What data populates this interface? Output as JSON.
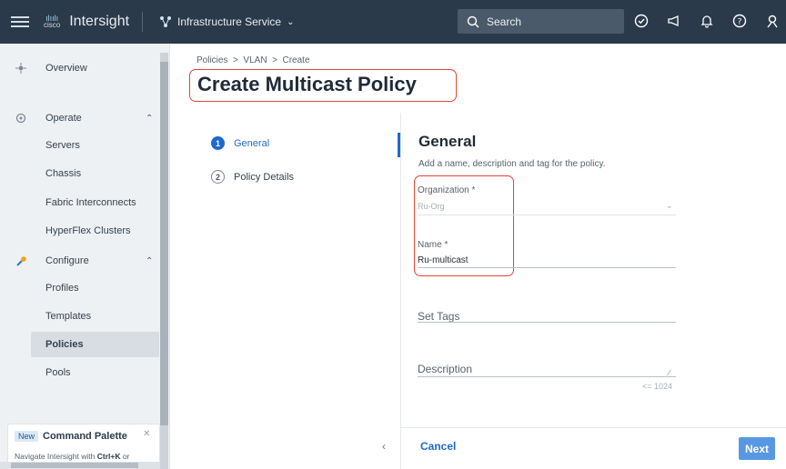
{
  "topbar": {
    "logo_text": "cisco",
    "brand": "Intersight",
    "service": "Infrastructure Service",
    "search_label": "Search"
  },
  "nav": {
    "overview": "Overview",
    "operate": "Operate",
    "servers": "Servers",
    "chassis": "Chassis",
    "fabric": "Fabric Interconnects",
    "hyperflex": "HyperFlex Clusters",
    "configure": "Configure",
    "profiles": "Profiles",
    "templates": "Templates",
    "policies": "Policies",
    "pools": "Pools"
  },
  "command_palette": {
    "badge": "New",
    "title": "Command Palette",
    "desc_prefix": "Navigate Intersight with ",
    "desc_key": "Ctrl+K",
    "desc_suffix": " or"
  },
  "breadcrumb": "Policies  >  VLAN  >  Create",
  "page_title": "Create Multicast Policy",
  "steps": [
    {
      "num": "1",
      "label": "General"
    },
    {
      "num": "2",
      "label": "Policy Details"
    }
  ],
  "form": {
    "title": "General",
    "subtitle": "Add a name, description and tag for the policy.",
    "org_label": "Organization *",
    "org_value": "Ru-Org",
    "name_label": "Name *",
    "name_value": "Ru-multicast",
    "tags_label": "Set Tags",
    "desc_label": "Description",
    "desc_counter": "<= 1024"
  },
  "footer": {
    "cancel": "Cancel",
    "next": "Next"
  },
  "colors": {
    "topbar": "#2b3a4a",
    "accent": "#1d69cc",
    "highlight": "#e0453a",
    "next_button": "#5897e2"
  }
}
